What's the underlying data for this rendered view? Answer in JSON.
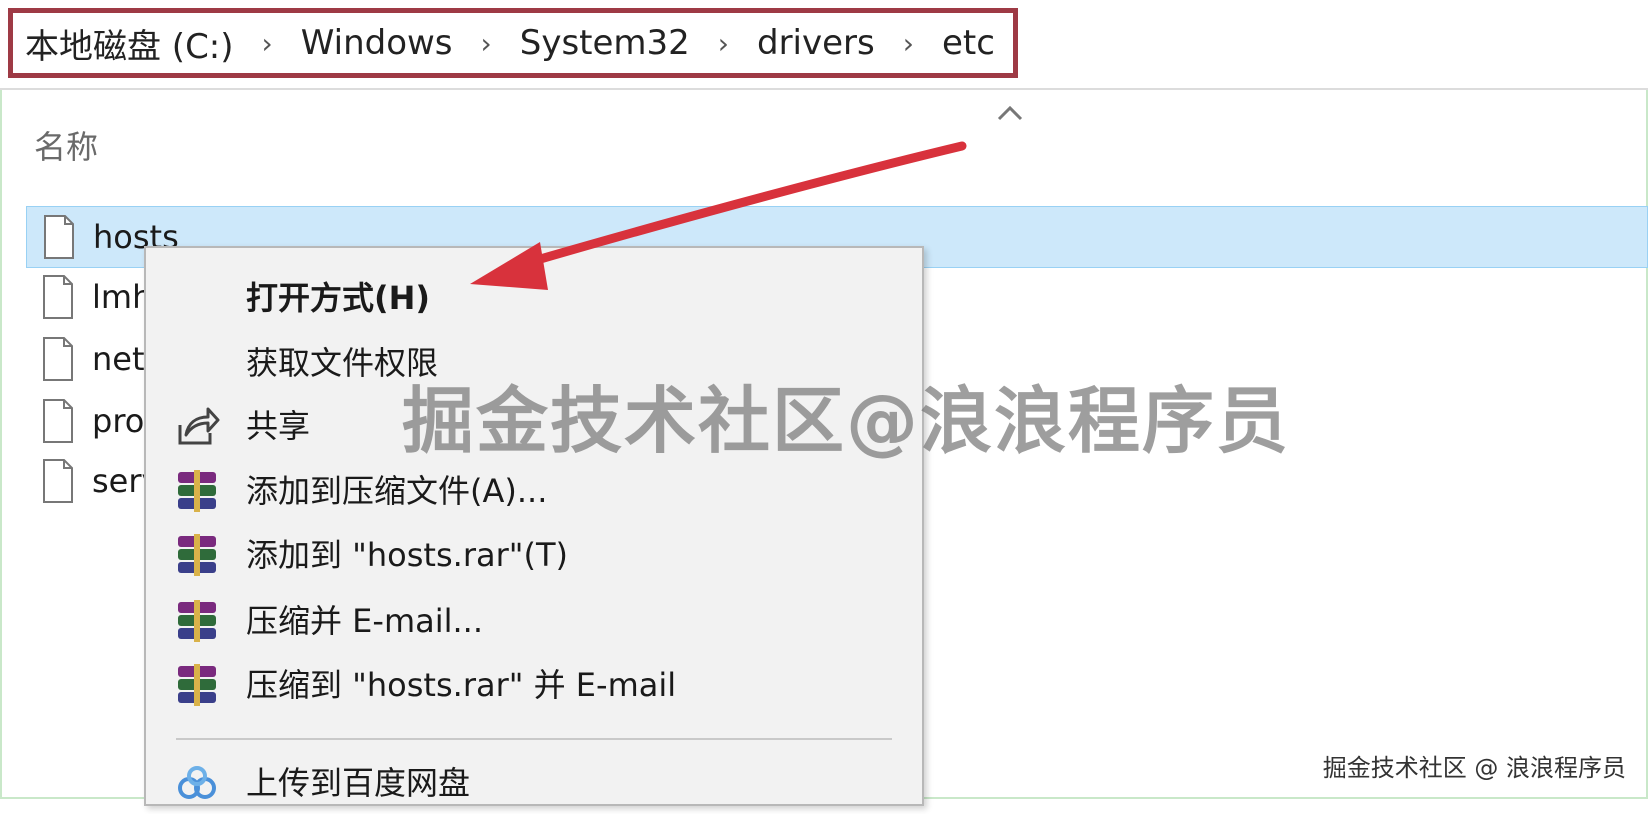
{
  "breadcrumb": [
    "本地磁盘 (C:)",
    "Windows",
    "System32",
    "drivers",
    "etc"
  ],
  "breadcrumb_separator": "›",
  "column_header": "名称",
  "files": [
    "hosts",
    "lmhosts.sam",
    "networks",
    "protocol",
    "services"
  ],
  "context_menu": {
    "items": [
      {
        "label": "打开方式(H)",
        "icon": ""
      },
      {
        "label": "获取文件权限",
        "icon": ""
      },
      {
        "label": "共享",
        "icon": "share-icon"
      },
      {
        "label": "添加到压缩文件(A)...",
        "icon": "winrar-icon"
      },
      {
        "label": "添加到 \"hosts.rar\"(T)",
        "icon": "winrar-icon"
      },
      {
        "label": "压缩并 E-mail...",
        "icon": "winrar-icon"
      },
      {
        "label": "压缩到 \"hosts.rar\" 并 E-mail",
        "icon": "winrar-icon"
      },
      {
        "label": "上传到百度网盘",
        "icon": "baidu-netdisk-icon"
      }
    ]
  },
  "watermark": "掘金技术社区@浪浪程序员",
  "watermark_small": "掘金技术社区 @ 浪浪程序员",
  "colors": {
    "highlight_box": "#9e3a45",
    "selection": "#cde8fa",
    "arrow": "#d8323c"
  }
}
